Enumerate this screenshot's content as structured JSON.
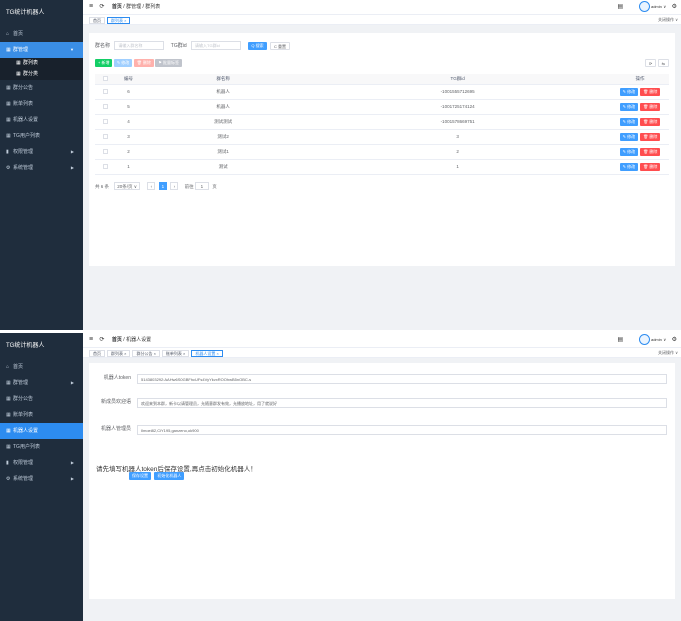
{
  "app_title": "TG统计机器人",
  "admin": "admin",
  "screen1": {
    "sidebar": [
      {
        "label": "首页",
        "icon": "home-icon",
        "glyph": "⌂",
        "caret": ""
      },
      {
        "label": "群管理",
        "icon": "grid-icon",
        "glyph": "▦",
        "caret": "▼",
        "state": "open"
      },
      {
        "label": "群列表",
        "icon": "grid-icon",
        "glyph": "▦",
        "caret": "",
        "state": "sub"
      },
      {
        "label": "群分类",
        "icon": "grid-icon",
        "glyph": "▦",
        "caret": "",
        "state": "sub"
      },
      {
        "label": "群分公告",
        "icon": "grid-icon",
        "glyph": "▦",
        "caret": ""
      },
      {
        "label": "账单列表",
        "icon": "grid-icon",
        "glyph": "▦",
        "caret": ""
      },
      {
        "label": "机器人设置",
        "icon": "grid-icon",
        "glyph": "▦",
        "caret": ""
      },
      {
        "label": "TG用户列表",
        "icon": "grid-icon",
        "glyph": "▦",
        "caret": ""
      },
      {
        "label": "权限管理",
        "icon": "bar-chart-icon",
        "glyph": "▮",
        "caret": "▶"
      },
      {
        "label": "系统管理",
        "icon": "settings-icon",
        "glyph": "⚙",
        "caret": "▶"
      }
    ],
    "breadcrumb": [
      "首页",
      "群管理",
      "群列表"
    ],
    "tabs": [
      {
        "label": "首页"
      },
      {
        "label": "群列表 ×",
        "active": true
      }
    ],
    "close_ops": "关闭操作 ∨",
    "search": {
      "group_label": "群名称",
      "group_placeholder": "请输入群名称",
      "tgid_label": "TG群id",
      "tgid_placeholder": "请输入TG群id",
      "search_btn": "Q 搜索",
      "reset_btn": "C 重置"
    },
    "toolbar": {
      "add": "+ 新增",
      "edit": "✎ 修改",
      "delete": "🗑 删除",
      "flag": "⚑ 批量标签",
      "refresh": "⟳",
      "columns": "⇆"
    },
    "table": {
      "headers": [
        "编号",
        "群名称",
        "TG群id",
        "操作"
      ],
      "rows": [
        {
          "id": "6",
          "name": "机器人",
          "tgid": "-1001555712695"
        },
        {
          "id": "5",
          "name": "机器人",
          "tgid": "-1001725174124"
        },
        {
          "id": "4",
          "name": "测试测试",
          "tgid": "-1001578669751"
        },
        {
          "id": "3",
          "name": "测试2",
          "tgid": "3"
        },
        {
          "id": "2",
          "name": "测试1",
          "tgid": "2"
        },
        {
          "id": "1",
          "name": "测试",
          "tgid": "1"
        }
      ],
      "edit_label": "✎ 修改",
      "delete_label": "🗑 删除"
    },
    "pager": {
      "total": "共 6 条",
      "size": "20条/页 ∨",
      "prev": "‹",
      "page": "1",
      "next": "›",
      "goto": "前往",
      "goto_value": "1",
      "unit": "页"
    }
  },
  "screen2": {
    "sidebar": [
      {
        "label": "首页",
        "icon": "home-icon",
        "glyph": "⌂",
        "caret": ""
      },
      {
        "label": "群管理",
        "icon": "grid-icon",
        "glyph": "▦",
        "caret": "▶"
      },
      {
        "label": "群分公告",
        "icon": "grid-icon",
        "glyph": "▦",
        "caret": ""
      },
      {
        "label": "账单列表",
        "icon": "grid-icon",
        "glyph": "▦",
        "caret": ""
      },
      {
        "label": "机器人设置",
        "icon": "grid-icon",
        "glyph": "▦",
        "caret": "",
        "state": "active"
      },
      {
        "label": "TG用户列表",
        "icon": "grid-icon",
        "glyph": "▦",
        "caret": ""
      },
      {
        "label": "权限管理",
        "icon": "bar-chart-icon",
        "glyph": "▮",
        "caret": "▶"
      },
      {
        "label": "系统管理",
        "icon": "settings-icon",
        "glyph": "⚙",
        "caret": "▶"
      }
    ],
    "breadcrumb": [
      "首页",
      "机器人设置"
    ],
    "tabs": [
      {
        "label": "首页"
      },
      {
        "label": "群列表 ×"
      },
      {
        "label": "群分公告 ×"
      },
      {
        "label": "账单列表 ×"
      },
      {
        "label": "机器人设置 ×",
        "active": true
      }
    ],
    "close_ops": "关闭操作 ∨",
    "form": {
      "token_label": "机器人token",
      "token_value": "5143803292:AAHw6S0GBFhcUFs4VyYkvxROOhwB5nOBC-s",
      "welcome_label": "新成员欢迎语",
      "welcome_value": "欢迎来到本群，新卡以请管理员，允随意群发有效，允播放地址，用了就说好",
      "admin_label": "机器人管理员",
      "admin_value": "Ilmoei82,CiY195,ganzeno,ok900"
    },
    "notice": "请先填写机器人token后保存设置,再点击初始化机器人！",
    "save_btn": "保存设置",
    "init_btn": "初始化机器人"
  }
}
